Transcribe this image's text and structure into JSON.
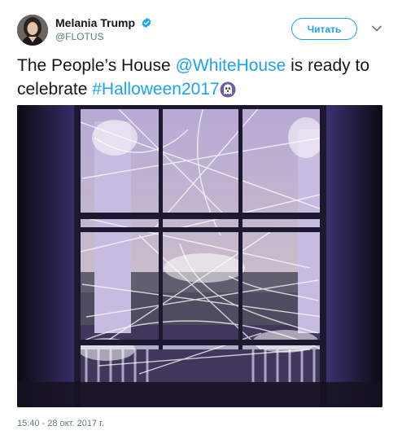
{
  "user": {
    "display_name": "Melania Trump",
    "handle": "@FLOTUS",
    "verified": true,
    "avatar_icon": "profile-photo"
  },
  "actions": {
    "follow_label": "Читать",
    "menu_icon": "chevron-down-icon"
  },
  "tweet": {
    "text_part1": "The People’s House ",
    "mention": "@WhiteHouse",
    "text_part2": " is ready to celebrate ",
    "hashtag": "#Halloween2017",
    "emoji_icon": "ghost-icon",
    "timestamp": "15:40 - 28 окт. 2017 г."
  },
  "colors": {
    "link": "#1da1f2",
    "text": "#14171a",
    "muted": "#657786"
  }
}
